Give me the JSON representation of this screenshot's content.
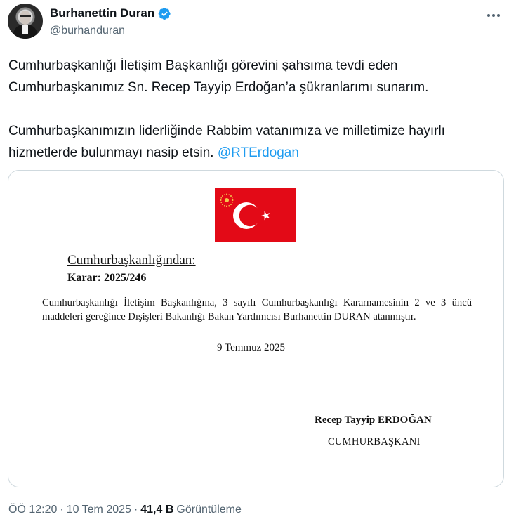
{
  "author": {
    "display_name": "Burhanettin Duran",
    "handle": "@burhanduran",
    "verified": true
  },
  "tweet": {
    "paragraph_1": "Cumhurbaşkanlığı İletişim Başkanlığı görevini şahsıma tevdi eden Cumhurbaşkanımız Sn. Recep Tayyip Erdoğan’a şükranlarımı sunarım.",
    "paragraph_2": "Cumhurbaşkanımızın liderliğinde Rabbim vatanımıza ve milletimize hayırlı hizmetlerde bulunmayı nasip etsin.",
    "mention": "@RTErdogan"
  },
  "document": {
    "heading": "Cumhurbaşkanlığından:",
    "decision": "Karar: 2025/246",
    "body": "Cumhurbaşkanlığı İletişim Başkanlığına, 3 sayılı Cumhurbaşkanlığı Kararnamesinin 2 ve 3 üncü maddeleri gereğince Dışişleri Bakanlığı Bakan Yardımcısı Burhanettin DURAN atanmıştır.",
    "date": "9 Temmuz 2025",
    "signature_name": "Recep Tayyip ERDOĞAN",
    "signature_title": "CUMHURBAŞKANI",
    "flag_color": "#e30a17"
  },
  "meta": {
    "time": "ÖÖ 12:20",
    "separator": "·",
    "date": "10 Tem 2025",
    "views_count": "41,4 B",
    "views_label": "Görüntüleme"
  },
  "colors": {
    "accent": "#1d9bf0",
    "secondary_text": "#536471",
    "primary_text": "#0f1419",
    "border": "#cfd9de"
  },
  "icons": {
    "verified": "verified-badge-icon",
    "more": "more-options-icon"
  }
}
